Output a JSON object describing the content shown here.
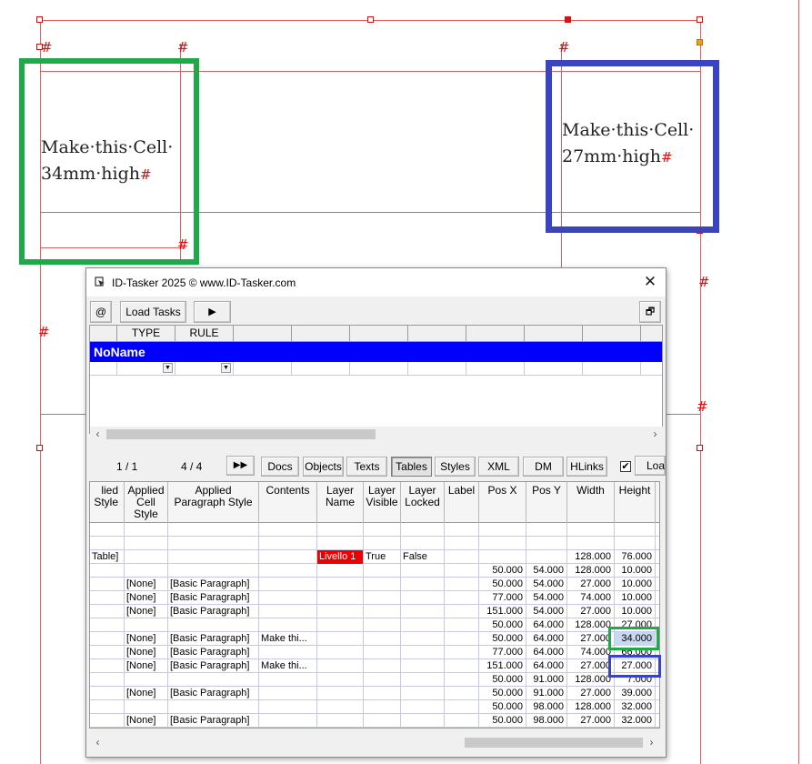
{
  "canvas": {
    "left_cell_text_line1": "Make·this·Cell·",
    "left_cell_text_line2": "34mm·high",
    "right_cell_text_line1": "Make·this·Cell·",
    "right_cell_text_line2": "27mm·high",
    "end_mark": "#",
    "left_highlight_color": "#1faa4a",
    "right_highlight_color": "#3a44c0"
  },
  "window": {
    "title": "ID-Tasker 2025  © www.ID-Tasker.com",
    "close": "✕",
    "at_button": "@",
    "load_tasks_button": "Load Tasks",
    "play_button": "▶",
    "restore_button": "🗗"
  },
  "task_grid": {
    "headers": [
      "TYPE",
      "RULE"
    ],
    "group_name": "NoName"
  },
  "nav": {
    "page_counter": "1 / 1",
    "item_counter": "4 / 4",
    "forward_button": "▶▶",
    "tabs": [
      "Docs",
      "Objects",
      "Texts",
      "Tables",
      "Styles",
      "XML",
      "DM",
      "HLinks"
    ],
    "active_tab": "Tables",
    "checkbox_checked": "✔",
    "load_button": "Loa"
  },
  "data_grid": {
    "headers": [
      "lied Style",
      "Applied Cell Style",
      "Applied Paragraph Style",
      "Contents",
      "Layer Name",
      "Layer Visible",
      "Layer Locked",
      "Label",
      "Pos X",
      "Pos Y",
      "Width",
      "Height"
    ],
    "rows": [
      [
        "",
        "",
        "",
        "",
        "",
        "",
        "",
        "",
        "",
        "",
        "",
        ""
      ],
      [
        "",
        "",
        "",
        "",
        "",
        "",
        "",
        "",
        "",
        "",
        "",
        ""
      ],
      [
        "Table]",
        "",
        "",
        "",
        "Livello 1",
        "True",
        "False",
        "",
        "",
        "",
        "128.000",
        "76.000"
      ],
      [
        "",
        "",
        "",
        "",
        "",
        "",
        "",
        "",
        "50.000",
        "54.000",
        "128.000",
        "10.000"
      ],
      [
        "",
        "[None]",
        "[Basic Paragraph]",
        "",
        "",
        "",
        "",
        "",
        "50.000",
        "54.000",
        "27.000",
        "10.000"
      ],
      [
        "",
        "[None]",
        "[Basic Paragraph]",
        "",
        "",
        "",
        "",
        "",
        "77.000",
        "54.000",
        "74.000",
        "10.000"
      ],
      [
        "",
        "[None]",
        "[Basic Paragraph]",
        "",
        "",
        "",
        "",
        "",
        "151.000",
        "54.000",
        "27.000",
        "10.000"
      ],
      [
        "",
        "",
        "",
        "",
        "",
        "",
        "",
        "",
        "50.000",
        "64.000",
        "128.000",
        "27.000"
      ],
      [
        "",
        "[None]",
        "[Basic Paragraph]",
        "Make thi...",
        "",
        "",
        "",
        "",
        "50.000",
        "64.000",
        "27.000",
        "34.000"
      ],
      [
        "",
        "[None]",
        "[Basic Paragraph]",
        "",
        "",
        "",
        "",
        "",
        "77.000",
        "64.000",
        "74.000",
        "66.000"
      ],
      [
        "",
        "[None]",
        "[Basic Paragraph]",
        "Make thi...",
        "",
        "",
        "",
        "",
        "151.000",
        "64.000",
        "27.000",
        "27.000"
      ],
      [
        "",
        "",
        "",
        "",
        "",
        "",
        "",
        "",
        "50.000",
        "91.000",
        "128.000",
        "7.000"
      ],
      [
        "",
        "[None]",
        "[Basic Paragraph]",
        "",
        "",
        "",
        "",
        "",
        "50.000",
        "91.000",
        "27.000",
        "39.000"
      ],
      [
        "",
        "",
        "",
        "",
        "",
        "",
        "",
        "",
        "50.000",
        "98.000",
        "128.000",
        "32.000"
      ],
      [
        "",
        "[None]",
        "[Basic Paragraph]",
        "",
        "",
        "",
        "",
        "",
        "50.000",
        "98.000",
        "27.000",
        "32.000"
      ]
    ]
  }
}
